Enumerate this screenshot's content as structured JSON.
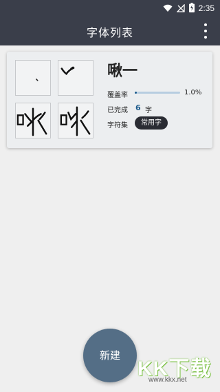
{
  "status_bar": {
    "time": "2:35",
    "icons": [
      "wifi-icon",
      "signal-off-icon",
      "battery-charging-icon"
    ]
  },
  "app_bar": {
    "title": "字体列表",
    "menu_icon": "more-vert-icon"
  },
  "font_card": {
    "font_name": "啾一",
    "coverage_label": "覆盖率",
    "coverage_value": "1.0%",
    "coverage_fraction": 0.01,
    "completed_label": "已完成",
    "completed_count": "6",
    "completed_unit": "字",
    "charset_label": "字符集",
    "charset_value": "常用字",
    "accent_color": "#1f5d8e",
    "preview_glyphs": [
      "glyph-dot",
      "glyph-stroke",
      "啾",
      "啾"
    ]
  },
  "fab": {
    "label": "新建",
    "color": "#546e86"
  },
  "watermark": {
    "text": "KK下载",
    "url": "www.kkx.net"
  }
}
